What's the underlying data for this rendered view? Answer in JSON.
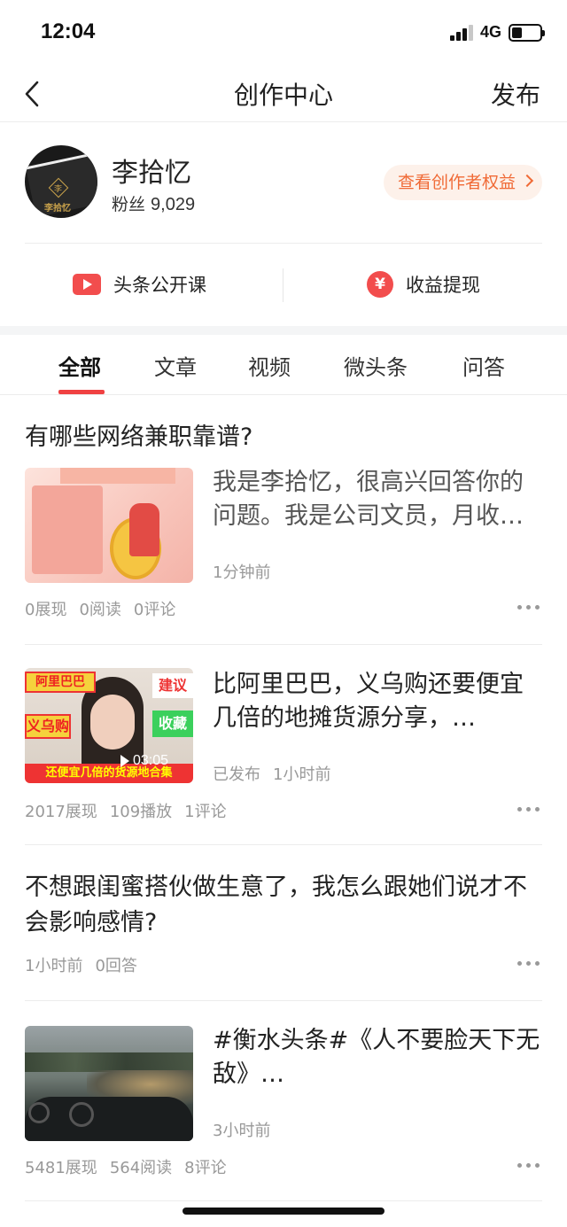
{
  "status_bar": {
    "time": "12:04",
    "network": "4G",
    "battery_level": 0.35
  },
  "nav": {
    "title": "创作中心",
    "publish_label": "发布"
  },
  "profile": {
    "name": "李拾忆",
    "fans_label": "粉丝",
    "fans_count": "9,029",
    "rights_label": "查看创作者权益",
    "avatar_text": "李拾忆",
    "avatar_badge": "李"
  },
  "quick_links": [
    {
      "label": "头条公开课",
      "icon": "play-icon"
    },
    {
      "label": "收益提现",
      "icon": "yen-icon",
      "icon_glyph": "¥"
    }
  ],
  "tabs": [
    "全部",
    "文章",
    "视频",
    "微头条",
    "问答"
  ],
  "active_tab": 0,
  "feed": [
    {
      "title": "有哪些网络兼职靠谱?",
      "summary": "我是李拾忆，很高兴回答你的问题。我是公司文员，月收…",
      "time": "1分钟前",
      "stats": [
        "0展现",
        "0阅读",
        "0评论"
      ]
    },
    {
      "summary": "比阿里巴巴，义乌购还要便宜几倍的地摊货源分享，…",
      "status": "已发布",
      "time": "1小时前",
      "duration": "03:05",
      "stats": [
        "2017展现",
        "109播放",
        "1评论"
      ],
      "thumb_tags": [
        "阿里巴巴",
        "义乌购",
        "建议",
        "收藏",
        "还便宜几倍的货源地合集"
      ]
    },
    {
      "title": "不想跟闺蜜搭伙做生意了，我怎么跟她们说才不会影响感情?",
      "meta": [
        "1小时前",
        "0回答"
      ]
    },
    {
      "summary": "#衡水头条#《人不要脸天下无敌》…",
      "time": "3小时前",
      "stats": [
        "5481展现",
        "564阅读",
        "8评论"
      ]
    }
  ]
}
